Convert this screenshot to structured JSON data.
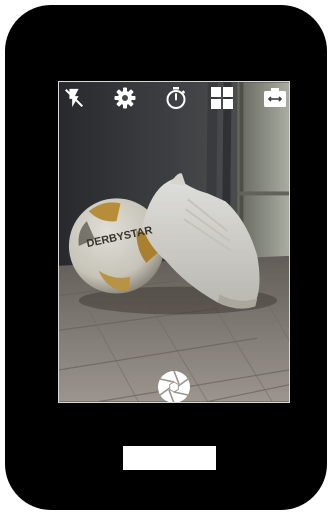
{
  "device": {
    "body_color": "#000000",
    "home_button_color": "#ffffff"
  },
  "camera": {
    "toolbar": [
      {
        "name": "flash-off",
        "icon": "flash-off-icon"
      },
      {
        "name": "settings",
        "icon": "gear-icon"
      },
      {
        "name": "timer",
        "icon": "stopwatch-icon"
      },
      {
        "name": "grid",
        "icon": "grid-icon"
      },
      {
        "name": "aspect-ratio",
        "icon": "aspect-ratio-icon"
      }
    ],
    "shutter": {
      "icon": "aperture-icon"
    },
    "preview_photo": {
      "ball_text": "DERBYSTAR"
    }
  }
}
